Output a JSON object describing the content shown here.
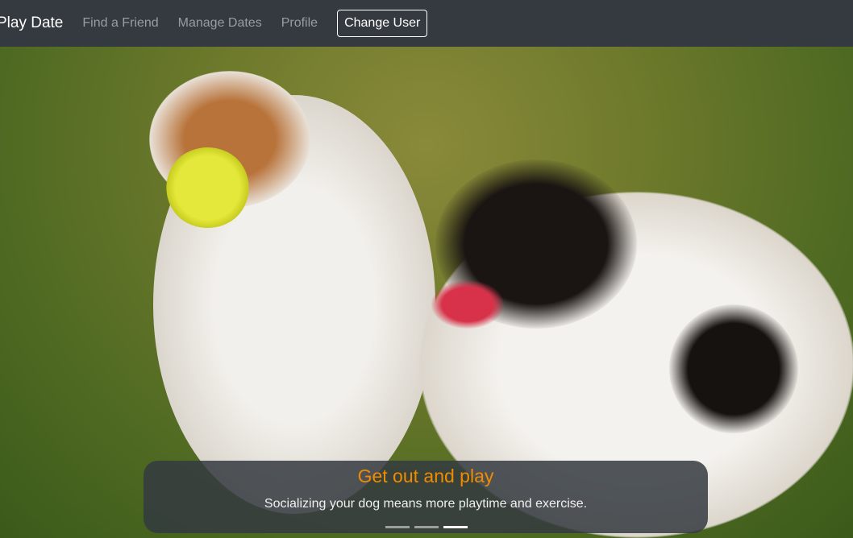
{
  "nav": {
    "brand": "Play Date",
    "links": [
      "Find a Friend",
      "Manage Dates",
      "Profile"
    ],
    "change_user": "Change User"
  },
  "carousel": {
    "title": "Get out and play",
    "text": "Socializing your dog means more playtime and exercise.",
    "slides": 3,
    "active_slide": 3,
    "title_color": "#f08c00"
  }
}
